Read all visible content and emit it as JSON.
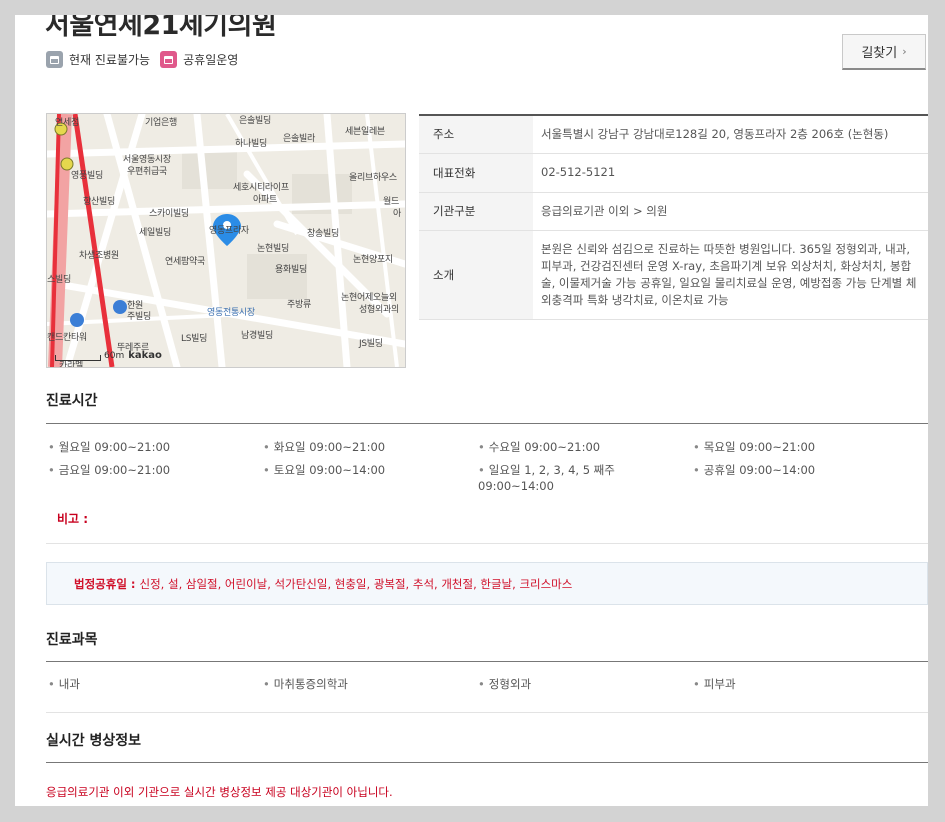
{
  "clinic": {
    "name": "서울연세21세기의원",
    "badges": [
      {
        "label": "현재 진료불가능",
        "icon": "calendar-icon",
        "color": "#9aa3ad"
      },
      {
        "label": "공휴일운영",
        "icon": "calendar-icon",
        "color": "#e0598b"
      }
    ],
    "directions_button": "길찾기",
    "directions_chevron": "›"
  },
  "map": {
    "labels": [
      "연세점",
      "기업은행",
      "은솔빌딩",
      "하나빌딩",
      "은솔빌라",
      "세븐일레븐",
      "서울영동시장",
      "우편취급국",
      "영풍빌딩",
      "올리브하우스",
      "향산빌딩",
      "세호시티라이프",
      "아파트",
      "월드",
      "아",
      "스카이빌딩",
      "세일빌딩",
      "영동프라자",
      "창송빌딩",
      "차생조병원",
      "연세팜약국",
      "논현빌딩",
      "용화빌딩",
      "논현양포지",
      "스빌딩",
      "한원",
      "주빌딩",
      "주방류",
      "논현어제오늘외",
      "성형외과의",
      "영동전통시장",
      "캔드칸타워",
      "뚜레주르",
      "LS빌딩",
      "남경빌딩",
      "JS빌딩",
      "카라멜"
    ],
    "scale_label": "60m",
    "provider": "kakao"
  },
  "info_table": [
    {
      "label": "주소",
      "value": "서울특별시 강남구 강남대로128길 20, 영동프라자 2층 206호 (논현동)"
    },
    {
      "label": "대표전화",
      "value": "02-512-5121"
    },
    {
      "label": "기관구분",
      "value": "응급의료기관 이외 > 의원"
    },
    {
      "label": "소개",
      "value": "본원은 신뢰와 섬김으로 진료하는 따뜻한 병원입니다. 365일 정형외과, 내과, 피부과, 건강검진센터 운영 X-ray, 초음파기계 보유 외상처치, 화상처치, 봉합술, 이물제거술 가능 공휴일, 일요일 물리치료실 운영, 예방접종 가능 단계별 체외충격파 특화 냉각치료, 이온치료 가능"
    }
  ],
  "hours": {
    "title": "진료시간",
    "items": [
      "월요일 09:00~21:00",
      "화요일 09:00~21:00",
      "수요일 09:00~21:00",
      "목요일 09:00~21:00",
      "금요일 09:00~21:00",
      "토요일 09:00~14:00",
      "일요일   1, 2, 3, 4, 5 째주 09:00~14:00",
      "공휴일 09:00~14:00"
    ],
    "remark_label": "비고 :"
  },
  "holidays": {
    "label": "법정공휴일 :",
    "value": "신정, 설, 삼일절, 어린이날, 석가탄신일, 현충일, 광복절, 추석, 개천절, 한글날, 크리스마스"
  },
  "departments": {
    "title": "진료과목",
    "items": [
      "내과",
      "마취통증의학과",
      "정형외과",
      "피부과"
    ]
  },
  "beds": {
    "title": "실시간 병상정보",
    "notice": "응급의료기관 이외 기관으로 실시간 병상정보 제공 대상기관이 아닙니다."
  }
}
